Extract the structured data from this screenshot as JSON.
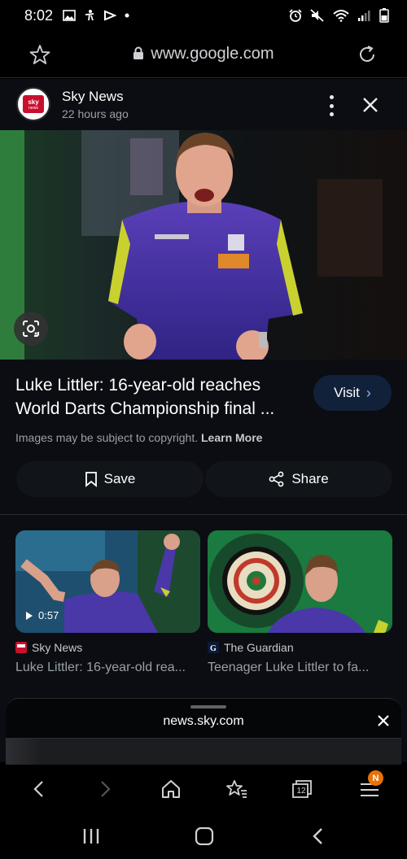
{
  "status_bar": {
    "time": "8:02",
    "left_icons": [
      "gallery-icon",
      "accessibility-icon",
      "media-icon",
      "dot-icon"
    ],
    "right_icons": [
      "alarm-icon",
      "mute-icon",
      "wifi-icon",
      "signal-icon",
      "battery-icon"
    ]
  },
  "url_bar": {
    "url": "www.google.com"
  },
  "panel": {
    "source_name": "Sky News",
    "source_time": "22 hours ago",
    "logo_text_top": "sky",
    "logo_text_bottom": "news",
    "headline": "Luke Littler: 16-year-old reaches World Darts Championship final ...",
    "visit_label": "Visit",
    "copyright_text": "Images may be subject to copyright.",
    "learn_more_label": "Learn More",
    "save_label": "Save",
    "share_label": "Share"
  },
  "related": [
    {
      "source": "Sky News",
      "title": "Luke Littler: 16-year-old rea...",
      "duration": "0:57"
    },
    {
      "source": "The Guardian",
      "title": "Teenager Luke Littler to fa..."
    }
  ],
  "sheet": {
    "domain": "news.sky.com"
  },
  "toolbar": {
    "badge": "N",
    "tabs_count": "12"
  },
  "colors": {
    "panel_bg": "#0b0d12",
    "visit_bg": "#12213a",
    "badge_orange": "#e8710a",
    "sky_red": "#c8102e",
    "link_blue": "#8ab4f8"
  }
}
